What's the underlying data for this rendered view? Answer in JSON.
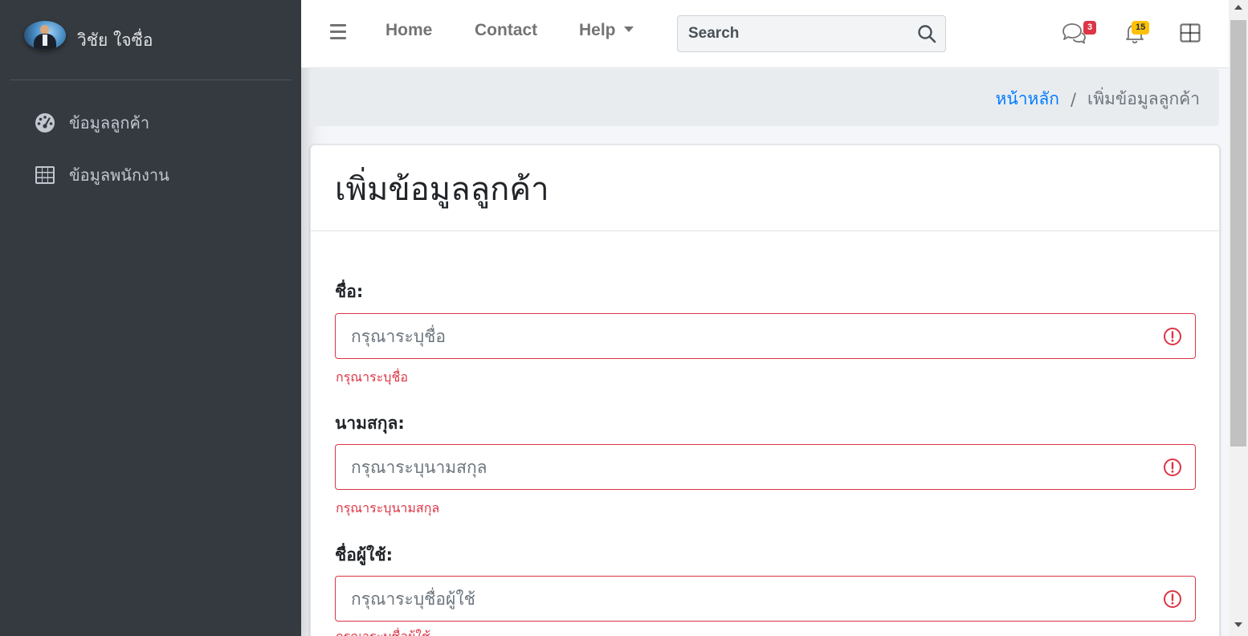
{
  "sidebar": {
    "brand_name": "วิชัย ใจซื่อ",
    "items": [
      {
        "label": "ข้อมูลลูกค้า",
        "icon": "tachometer-icon"
      },
      {
        "label": "ข้อมูลพนักงาน",
        "icon": "table-icon"
      }
    ]
  },
  "topbar": {
    "menu_icon": "hamburger-icon",
    "links": [
      {
        "label": "Home"
      },
      {
        "label": "Contact"
      },
      {
        "label": "Help"
      }
    ],
    "search": {
      "placeholder": "Search",
      "icon": "search-icon"
    },
    "messages": {
      "icon": "comments-icon",
      "badge": "3",
      "badge_color": "#dc3545"
    },
    "notifications": {
      "icon": "bell-icon",
      "badge": "15",
      "badge_color": "#ffc107"
    },
    "apps": {
      "icon": "grid-icon"
    }
  },
  "breadcrumb": {
    "home": "หน้าหลัก",
    "separator": "/",
    "current": "เพิ่มข้อมูลลูกค้า"
  },
  "form": {
    "title": "เพิ่มข้อมูลลูกค้า",
    "error_color": "#dc3545",
    "fields": [
      {
        "label": "ชื่อ:",
        "value": "",
        "placeholder": "กรุณาระบุชื่อ",
        "error": "กรุณาระบุชื่อ"
      },
      {
        "label": "นามสกุล:",
        "value": "",
        "placeholder": "กรุณาระบุนามสกุล",
        "error": "กรุณาระบุนามสกุล"
      },
      {
        "label": "ชื่อผู้ใช้:",
        "value": "",
        "placeholder": "กรุณาระบุชื่อผู้ใช้",
        "error": "กรุณาระบุชื่อผู้ใช้"
      }
    ]
  },
  "colors": {
    "sidebar_bg": "#343a40",
    "link": "#007bff",
    "danger": "#dc3545",
    "warning": "#ffc107"
  }
}
